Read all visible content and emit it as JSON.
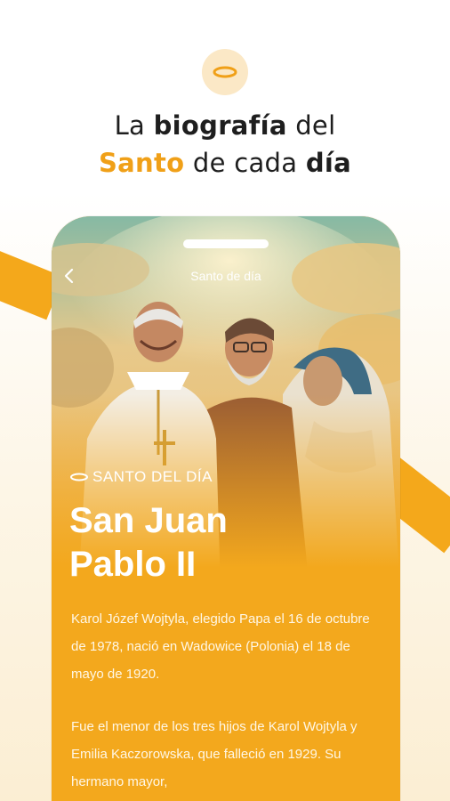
{
  "header": {
    "line1_prefix": "La ",
    "line1_bold": "biografía",
    "line1_suffix": " del",
    "line2_accent": "Santo",
    "line2_middle": " de cada ",
    "line2_bold": "día"
  },
  "phone": {
    "screen_title": "Santo de día",
    "back_icon": "chevron-left-icon",
    "tag_label": "SANTO DEL DÍA",
    "saint_name_line1": "San Juan",
    "saint_name_line2": "Pablo II",
    "paragraphs": [
      "Karol Józef Wojtyla, elegido Papa el 16 de octubre de 1978, nació en Wadowice (Polonia) el 18 de mayo de 1920.",
      "Fue el menor de los tres hijos de Karol Wojtyla y Emilia Kaczorowska, que falleció en 1929. Su hermano mayor,"
    ]
  },
  "colors": {
    "accent": "#f0a018",
    "panel": "#f3a81d",
    "logo_bg": "#fbe8c6"
  }
}
